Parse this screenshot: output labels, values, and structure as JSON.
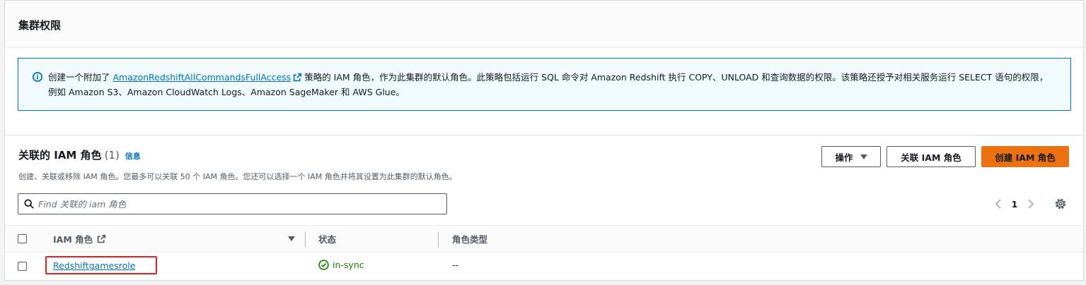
{
  "permissions": {
    "title": "集群权限",
    "alert": {
      "text_before": "创建一个附加了",
      "policy_link": "AmazonRedshiftAllCommandsFullAccess",
      "text_after": "策略的 IAM 角色，作为此集群的默认角色。此策略包括运行 SQL 命令对 Amazon Redshift 执行 COPY、UNLOAD 和查询数据的权限。该策略还授予对相关服务运行 SELECT 语句的权限，例如 Amazon S3、Amazon CloudWatch Logs、Amazon SageMaker 和 AWS Glue。"
    }
  },
  "roles": {
    "title": "关联的 IAM 角色",
    "count": "(1)",
    "info_link": "信息",
    "description": "创建、关联或移除 IAM 角色。您最多可以关联 50 个 IAM 角色。您还可以选择一个 IAM 角色并将其设置为此集群的默认角色。",
    "buttons": {
      "actions": "操作",
      "associate": "关联 IAM 角色",
      "create": "创建 IAM 角色"
    },
    "search": {
      "placeholder": "Find 关联的 iam 角色",
      "value": ""
    },
    "pagination": {
      "current_page": "1"
    },
    "table": {
      "columns": [
        "IAM 角色",
        "状态",
        "角色类型"
      ],
      "rows": [
        {
          "role": "Redshiftgamesrole",
          "status": "in-sync",
          "type": "--"
        }
      ]
    }
  },
  "colors": {
    "primary_button": "#ec7211",
    "link": "#0073bb",
    "success": "#1d8102",
    "highlight": "#e02020"
  }
}
